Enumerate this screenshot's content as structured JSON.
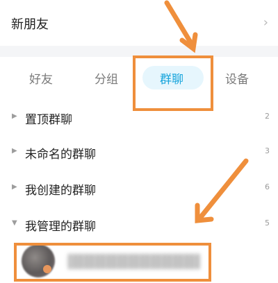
{
  "new_friends": {
    "label": "新朋友",
    "chevron": "›"
  },
  "tabs": [
    {
      "label": "好友",
      "active": false
    },
    {
      "label": "分组",
      "active": false
    },
    {
      "label": "群聊",
      "active": true
    },
    {
      "label": "设备",
      "active": false
    }
  ],
  "groups": [
    {
      "label": "置顶群聊",
      "count": "2",
      "expanded": false
    },
    {
      "label": "未命名的群聊",
      "count": "3",
      "expanded": false
    },
    {
      "label": "我创建的群聊",
      "count": "6",
      "expanded": false
    },
    {
      "label": "我管理的群聊",
      "count": "5",
      "expanded": true
    }
  ],
  "expanded_items": [
    {
      "name": "",
      "avatar": "blurred-avatar"
    }
  ],
  "colors": {
    "accent": "#18a5dc",
    "accent_bg": "#e6f6fd",
    "annotation": "#ef8f3c"
  },
  "icons": {
    "collapsed": "▶",
    "expanded": "▼"
  }
}
